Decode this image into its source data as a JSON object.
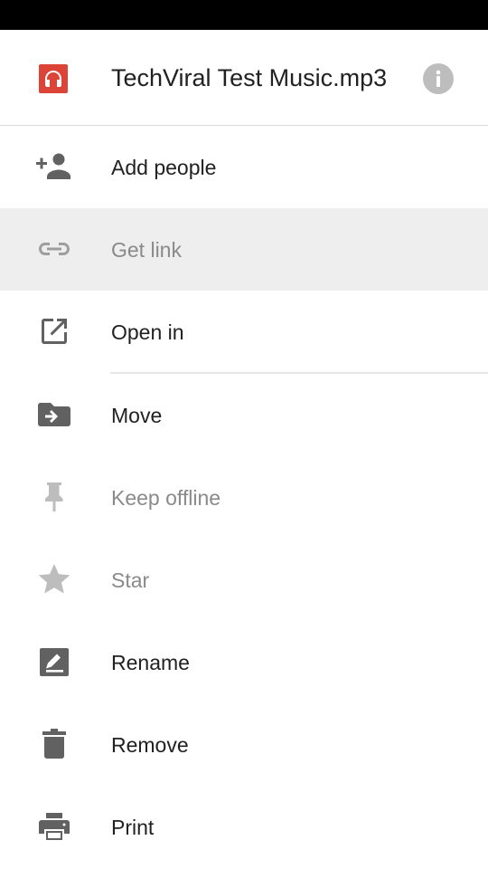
{
  "file": {
    "title": "TechViral Test Music.mp3",
    "icon": "audio-headphones-icon",
    "icon_color": "#db4437"
  },
  "info_icon": "info-icon",
  "menu": {
    "items": [
      {
        "label": "Add people",
        "icon": "add-person-icon"
      },
      {
        "label": "Get link",
        "icon": "link-icon",
        "state": "highlighted-disabled"
      },
      {
        "label": "Open in",
        "icon": "open-in-new-icon"
      },
      {
        "label": "Move",
        "icon": "move-to-folder-icon"
      },
      {
        "label": "Keep offline",
        "icon": "pin-icon",
        "state": "disabled"
      },
      {
        "label": "Star",
        "icon": "star-icon",
        "state": "disabled"
      },
      {
        "label": "Rename",
        "icon": "rename-icon"
      },
      {
        "label": "Remove",
        "icon": "trash-icon"
      },
      {
        "label": "Print",
        "icon": "printer-icon"
      }
    ]
  },
  "colors": {
    "icon_gray": "#616161",
    "icon_light_gray": "#bdbdbd",
    "highlight_bg": "#eeeeee",
    "text_primary": "#212121",
    "text_disabled": "#8a8a8a"
  }
}
